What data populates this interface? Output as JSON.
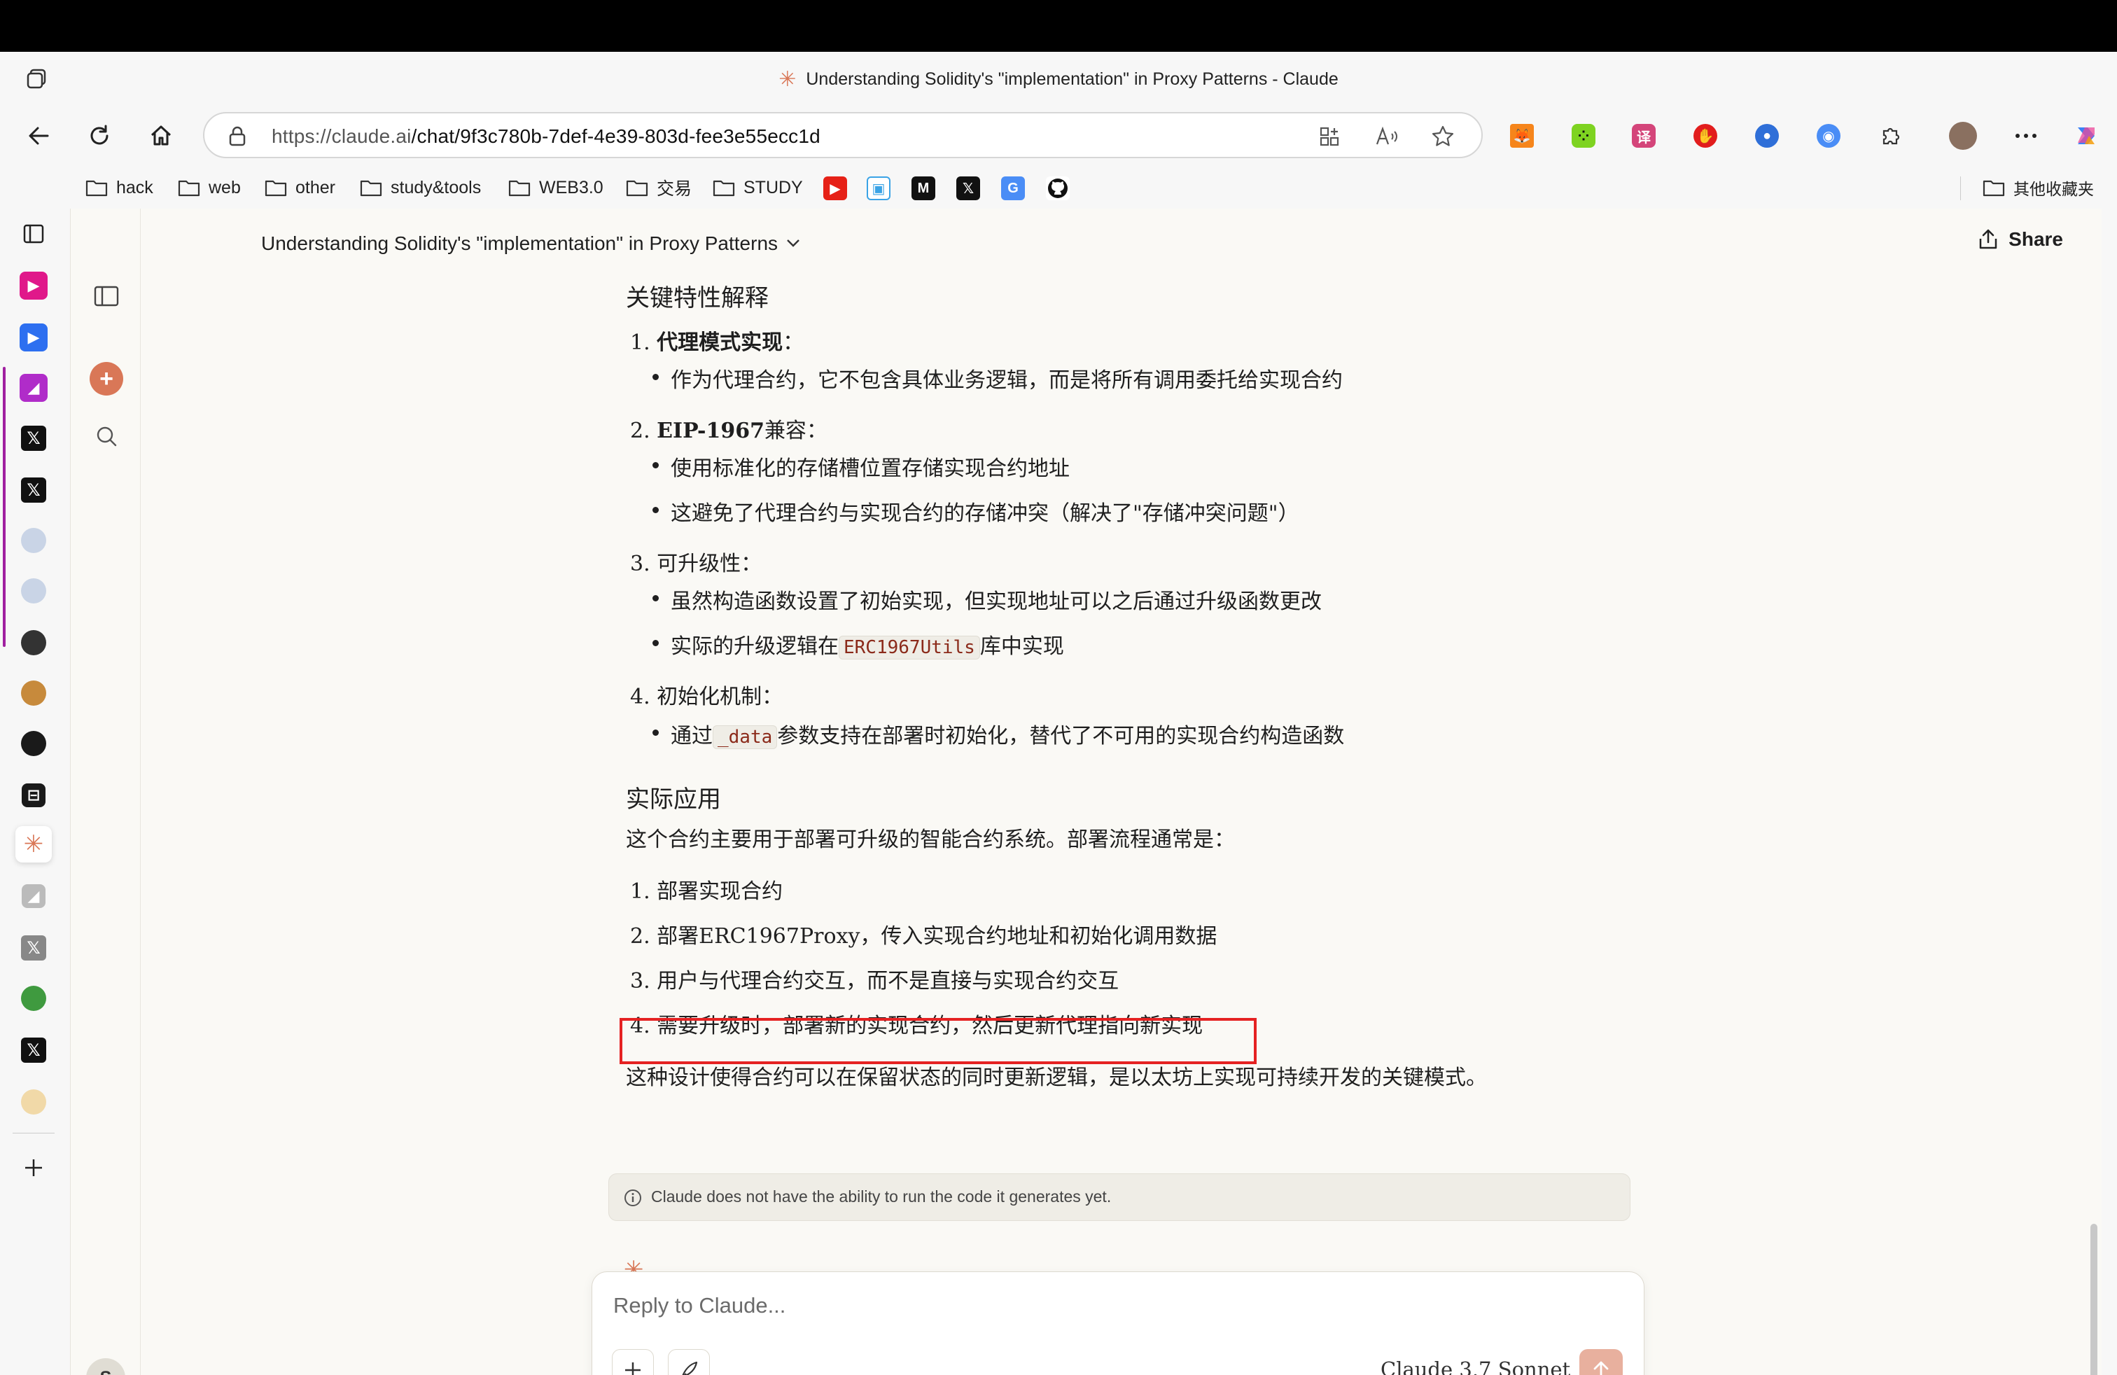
{
  "browser": {
    "window_title": "Understanding Solidity's \"implementation\" in Proxy Patterns - Claude",
    "url_host": "https://claude.ai",
    "url_path": "/chat/9f3c780b-7def-4e39-803d-fee3e55ecc1d"
  },
  "bookmarks": [
    {
      "label": "hack"
    },
    {
      "label": "web"
    },
    {
      "label": "other"
    },
    {
      "label": "study&tools"
    },
    {
      "label": "WEB3.0"
    },
    {
      "label": "交易"
    },
    {
      "label": "STUDY"
    }
  ],
  "bookmarks_other": "其他收藏夹",
  "chat": {
    "title": "Understanding Solidity's \"implementation\" in Proxy Patterns",
    "share_label": "Share",
    "avatar_initial": "S"
  },
  "message": {
    "section1_heading": "关键特性解释",
    "items": [
      {
        "num": "1.",
        "bold": "代理模式实现",
        "rest": "：",
        "bullets": [
          {
            "text": "作为代理合约，它不包含具体业务逻辑，而是将所有调用委托给实现合约"
          }
        ]
      },
      {
        "num": "2.",
        "bold": "EIP-1967",
        "rest": "兼容：",
        "bullets": [
          {
            "text": "使用标准化的存储槽位置存储实现合约地址"
          },
          {
            "text": "这避免了代理合约与实现合约的存储冲突（解决了\"存储冲突问题\"）"
          }
        ]
      },
      {
        "num": "3.",
        "bold": "可升级性",
        "rest": "：",
        "bullets": [
          {
            "text": "虽然构造函数设置了初始实现，但实现地址可以之后通过升级函数更改"
          },
          {
            "pre": "实际的升级逻辑在",
            "code": "ERC1967Utils",
            "post": "库中实现"
          }
        ]
      },
      {
        "num": "4.",
        "bold": "初始化机制",
        "rest": "：",
        "bullets": [
          {
            "pre": "通过",
            "code": "_data",
            "post": "参数支持在部署时初始化，替代了不可用的实现合约构造函数"
          }
        ]
      }
    ],
    "section2_heading": "实际应用",
    "section2_intro": "这个合约主要用于部署可升级的智能合约系统。部署流程通常是：",
    "steps": [
      {
        "num": "1.",
        "text": "部署实现合约"
      },
      {
        "num": "2.",
        "text": "部署ERC1967Proxy，传入实现合约地址和初始化调用数据"
      },
      {
        "num": "3.",
        "text": "用户与代理合约交互，而不是直接与实现合约交互"
      },
      {
        "num": "4.",
        "text": "需要升级时，部署新的实现合约，然后更新代理指向新实现"
      }
    ],
    "conclusion": "这种设计使得合约可以在保留状态的同时更新逻辑，是以太坊上实现可持续开发的关键模式。"
  },
  "notice": "Claude does not have the ability to run the code it generates yet.",
  "composer": {
    "placeholder": "Reply to Claude...",
    "model": "Claude 3.7 Sonnet"
  },
  "colors": {
    "accent": "#d97757",
    "highlight": "#e52222",
    "page_bg": "#faf9f5"
  }
}
